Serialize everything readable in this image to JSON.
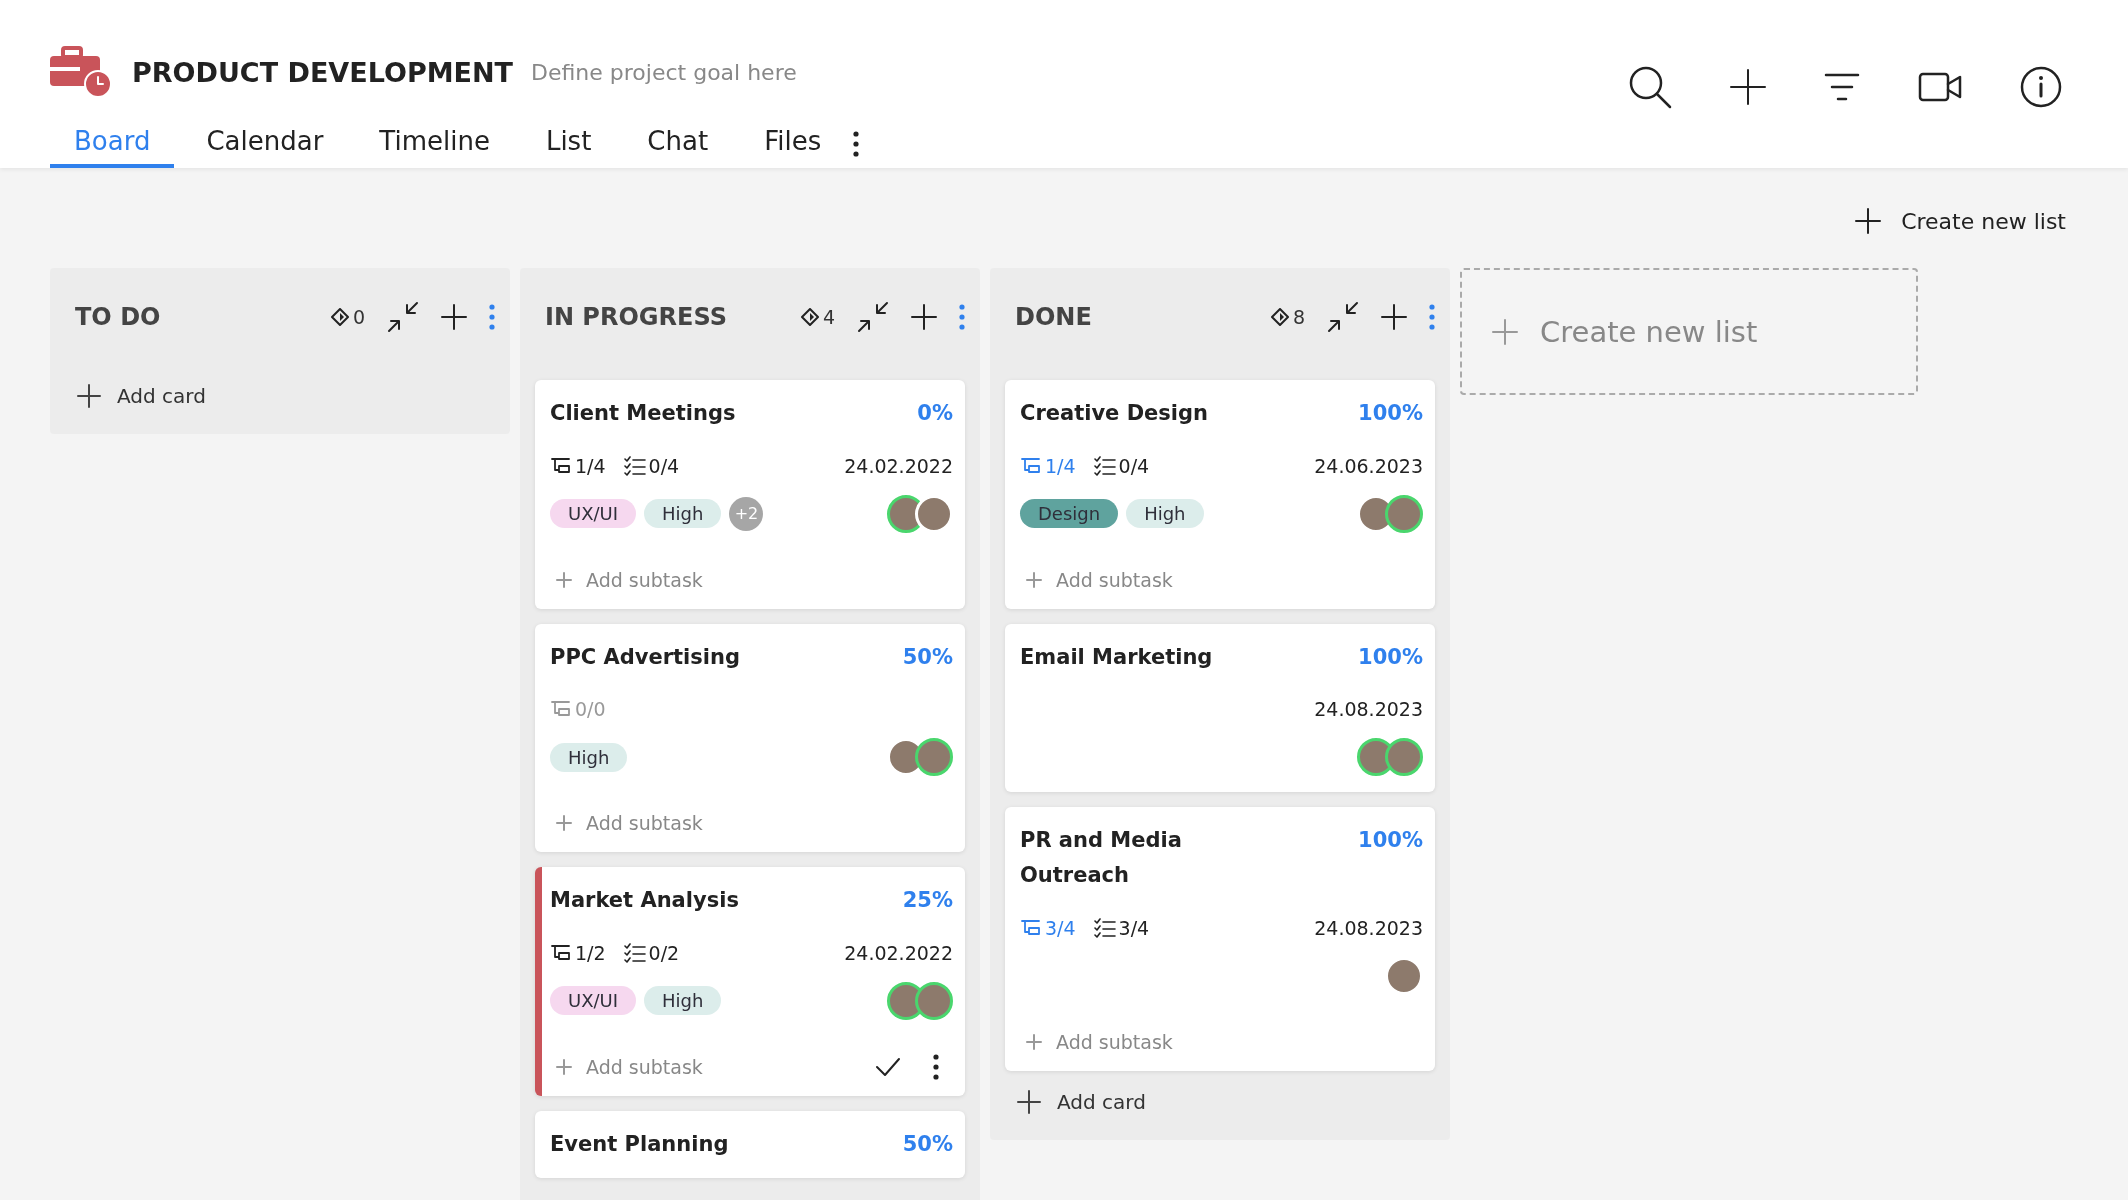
{
  "header": {
    "title": "PRODUCT DEVELOPMENT",
    "goal": {
      "placeholder": "Define project goal here"
    }
  },
  "tabs": [
    {
      "label": "Board",
      "selected": true
    },
    {
      "label": "Calendar",
      "selected": false
    },
    {
      "label": "Timeline",
      "selected": false
    },
    {
      "label": "List",
      "selected": false
    },
    {
      "label": "Chat",
      "selected": false
    },
    {
      "label": "Files",
      "selected": false
    }
  ],
  "toolbar": {
    "create_list": "Create new list"
  },
  "columns": [
    {
      "name": "TO DO",
      "count": "0",
      "add_card": "Add card"
    },
    {
      "name": "IN PROGRESS",
      "count": "4",
      "cards": [
        {
          "title": "Client Meetings",
          "progress": "0%",
          "flagged": false,
          "subtasks": {
            "text": "1/4",
            "complete": false,
            "disabled": false
          },
          "checklist": {
            "text": "0/4"
          },
          "date": "24.02.2022",
          "tags": [
            {
              "label": "UX/UI",
              "color": "#f6d8ef"
            },
            {
              "label": "High",
              "color": "#dcedeb"
            }
          ],
          "more_tags": "+2",
          "avatars": [
            {
              "ring": true
            },
            {
              "ring": false
            }
          ],
          "add_subtask": "Add subtask",
          "actions_visible": false
        },
        {
          "title": "PPC Advertising",
          "progress": "50%",
          "flagged": false,
          "subtasks": {
            "text": "0/0",
            "complete": false,
            "disabled": true
          },
          "tags": [
            {
              "label": "High",
              "color": "#dcedeb"
            }
          ],
          "avatars": [
            {
              "ring": false
            },
            {
              "ring": true
            }
          ],
          "add_subtask": "Add subtask",
          "actions_visible": false
        },
        {
          "title": "Market Analysis",
          "progress": "25%",
          "flagged": true,
          "subtasks": {
            "text": "1/2",
            "complete": false,
            "disabled": false
          },
          "checklist": {
            "text": "0/2"
          },
          "date": "24.02.2022",
          "tags": [
            {
              "label": "UX/UI",
              "color": "#f6d8ef"
            },
            {
              "label": "High",
              "color": "#dcedeb"
            }
          ],
          "avatars": [
            {
              "ring": true
            },
            {
              "ring": true
            }
          ],
          "add_subtask": "Add subtask",
          "actions_visible": true
        },
        {
          "title": "Event Planning",
          "progress": "50%",
          "flagged": false
        }
      ]
    },
    {
      "name": "DONE",
      "count": "8",
      "add_card": "Add card",
      "cards": [
        {
          "title": "Creative Design",
          "progress": "100%",
          "flagged": false,
          "subtasks": {
            "text": "1/4",
            "complete": true,
            "disabled": false
          },
          "checklist": {
            "text": "0/4"
          },
          "date": "24.06.2023",
          "tags": [
            {
              "label": "Design",
              "color": "#5fa39e"
            },
            {
              "label": "High",
              "color": "#dcedeb"
            }
          ],
          "avatars": [
            {
              "ring": false
            },
            {
              "ring": true
            }
          ],
          "add_subtask": "Add subtask",
          "actions_visible": false
        },
        {
          "title": "Email Marketing",
          "progress": "100%",
          "flagged": false,
          "date": "24.08.2023",
          "avatars": [
            {
              "ring": true
            },
            {
              "ring": true
            }
          ],
          "actions_visible": false
        },
        {
          "title": "PR and Media Outreach",
          "progress": "100%",
          "flagged": false,
          "subtasks": {
            "text": "3/4",
            "complete": true,
            "disabled": false
          },
          "checklist": {
            "text": "3/4"
          },
          "date": "24.08.2023",
          "avatars": [
            {
              "ring": false
            }
          ],
          "add_subtask": "Add subtask",
          "actions_visible": false
        }
      ]
    }
  ],
  "new_list": {
    "label": "Create new list"
  }
}
